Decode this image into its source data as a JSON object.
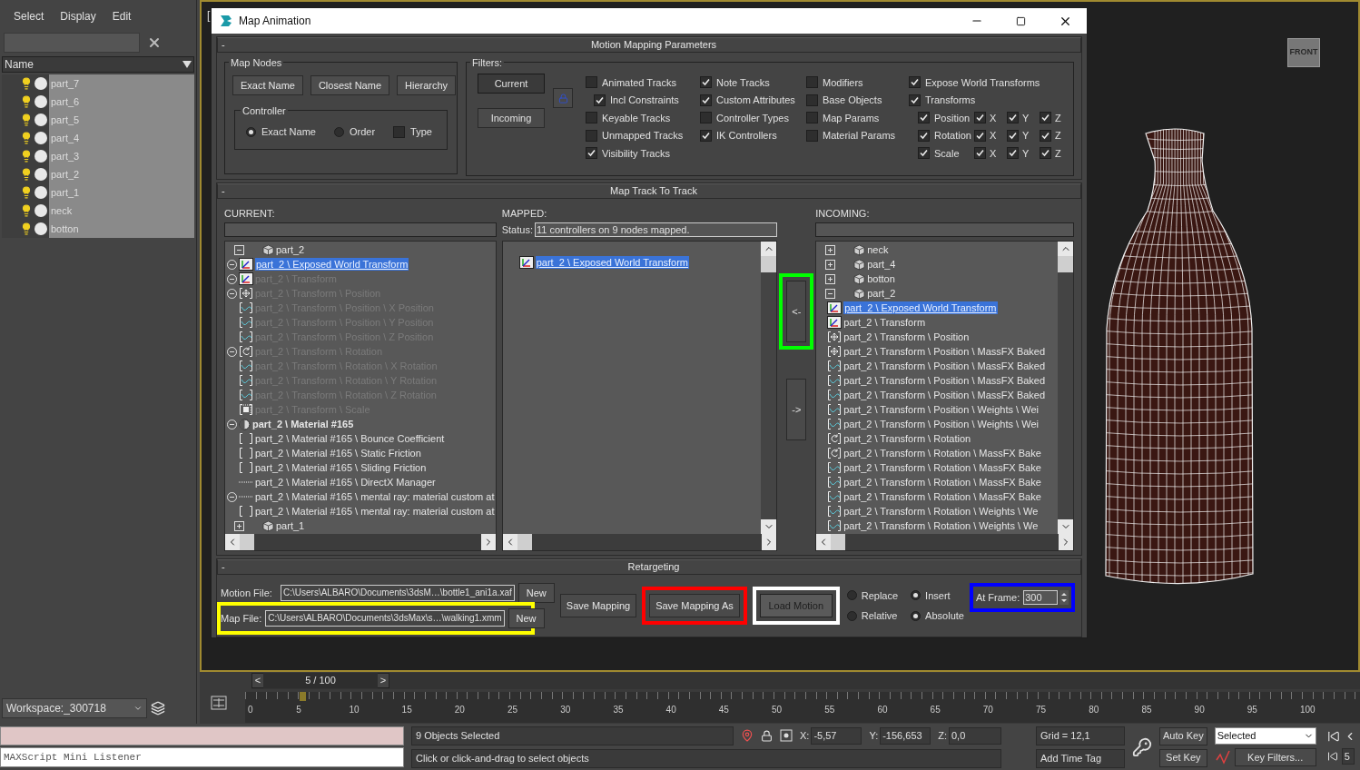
{
  "explorer": {
    "menu": [
      "Select",
      "Display",
      "Edit"
    ],
    "column": "Name",
    "items": [
      {
        "name": "part_7",
        "selected": true
      },
      {
        "name": "part_6",
        "selected": true
      },
      {
        "name": "part_5",
        "selected": true
      },
      {
        "name": "part_4",
        "selected": true
      },
      {
        "name": "part_3",
        "selected": true
      },
      {
        "name": "part_2",
        "selected": true
      },
      {
        "name": "part_1",
        "selected": true
      },
      {
        "name": "neck",
        "selected": true
      },
      {
        "name": "botton",
        "selected": true
      }
    ],
    "workspace": "Workspace:_300718"
  },
  "viewport": {
    "label": "[",
    "viewcube": "FRONT"
  },
  "dialog": {
    "title": "Map Animation",
    "motion_mapping": {
      "collapse": "-",
      "title": "Motion Mapping Parameters",
      "map_nodes": {
        "title": "Map Nodes",
        "buttons": [
          "Exact Name",
          "Closest Name",
          "Hierarchy"
        ],
        "controller": {
          "title": "Controller",
          "options": [
            {
              "label": "Exact Name",
              "kind": "radio",
              "selected": true
            },
            {
              "label": "Order",
              "kind": "radio",
              "selected": false
            },
            {
              "label": "Type",
              "kind": "checkbox",
              "checked": false
            }
          ]
        }
      },
      "filters": {
        "title": "Filters:",
        "modes": [
          {
            "label": "Current",
            "selected": true
          },
          {
            "label": "Incoming",
            "selected": false
          }
        ],
        "columns": [
          [
            {
              "label": "Animated Tracks",
              "checked": false,
              "kind": "plain"
            },
            {
              "label": "Incl Constraints",
              "checked": true,
              "kind": "sub"
            },
            {
              "label": "Keyable Tracks",
              "checked": false,
              "kind": "plain"
            },
            {
              "label": "Unmapped Tracks",
              "checked": false,
              "kind": "plain"
            },
            {
              "label": "Visibility Tracks",
              "checked": true,
              "kind": "plain"
            }
          ],
          [
            {
              "label": "Note Tracks",
              "checked": true,
              "kind": "plain"
            },
            {
              "label": "Custom Attributes",
              "checked": true,
              "kind": "plain"
            },
            {
              "label": "Controller Types",
              "checked": false,
              "kind": "plain"
            },
            {
              "label": "IK Controllers",
              "checked": true,
              "kind": "plain"
            }
          ],
          [
            {
              "label": "Modifiers",
              "checked": false,
              "kind": "plain"
            },
            {
              "label": "Base Objects",
              "checked": false,
              "kind": "plain"
            },
            {
              "label": "Map Params",
              "checked": false,
              "kind": "plain"
            },
            {
              "label": "Material Params",
              "checked": false,
              "kind": "plain"
            }
          ],
          [
            {
              "label": "Expose World Transforms",
              "checked": true,
              "kind": "plain"
            },
            {
              "label": "Transforms",
              "checked": true,
              "kind": "plain"
            }
          ]
        ],
        "transforms": [
          {
            "label": "Position",
            "checked": true,
            "axes": [
              {
                "label": "X",
                "checked": true
              },
              {
                "label": "Y",
                "checked": true
              },
              {
                "label": "Z",
                "checked": true
              }
            ]
          },
          {
            "label": "Rotation",
            "checked": true,
            "axes": [
              {
                "label": "X",
                "checked": true
              },
              {
                "label": "Y",
                "checked": true
              },
              {
                "label": "Z",
                "checked": true
              }
            ]
          },
          {
            "label": "Scale",
            "checked": true,
            "axes": [
              {
                "label": "X",
                "checked": true
              },
              {
                "label": "Y",
                "checked": true
              },
              {
                "label": "Z",
                "checked": true
              }
            ]
          }
        ]
      }
    },
    "map_track": {
      "collapse": "-",
      "title": "Map Track To Track",
      "current": {
        "label": "CURRENT:",
        "rows": [
          {
            "text": "part_2",
            "kind": "node",
            "expanded": true,
            "selected": false,
            "disabled": false
          },
          {
            "text": "part_2 \\ Exposed World Transform",
            "kind": "transform",
            "expanded": true,
            "selected": true,
            "disabled": false
          },
          {
            "text": "part_2 \\ Transform",
            "kind": "transform",
            "expanded": true,
            "selected": false,
            "disabled": true
          },
          {
            "text": "part_2 \\ Transform \\ Position",
            "kind": "position",
            "expanded": true,
            "selected": false,
            "disabled": true
          },
          {
            "text": "part_2 \\ Transform \\ Position \\ X Position",
            "kind": "curve",
            "selected": false,
            "disabled": true
          },
          {
            "text": "part_2 \\ Transform \\ Position \\ Y Position",
            "kind": "curve",
            "selected": false,
            "disabled": true
          },
          {
            "text": "part_2 \\ Transform \\ Position \\ Z Position",
            "kind": "curve",
            "selected": false,
            "disabled": true
          },
          {
            "text": "part_2 \\ Transform \\ Rotation",
            "kind": "rotation",
            "expanded": true,
            "selected": false,
            "disabled": true
          },
          {
            "text": "part_2 \\ Transform \\ Rotation \\ X Rotation",
            "kind": "curve",
            "selected": false,
            "disabled": true
          },
          {
            "text": "part_2 \\ Transform \\ Rotation \\ Y Rotation",
            "kind": "curve",
            "selected": false,
            "disabled": true
          },
          {
            "text": "part_2 \\ Transform \\ Rotation \\ Z Rotation",
            "kind": "curve",
            "selected": false,
            "disabled": true
          },
          {
            "text": "part_2 \\ Transform \\ Scale",
            "kind": "scale",
            "selected": false,
            "disabled": true
          },
          {
            "text": "part_2 \\ Material #165",
            "kind": "material",
            "expanded": true,
            "selected": false,
            "disabled": false
          },
          {
            "text": "part_2 \\ Material #165 \\ Bounce Coefficient",
            "kind": "bracket",
            "selected": false,
            "disabled": false
          },
          {
            "text": "part_2 \\ Material #165 \\ Static Friction",
            "kind": "bracket",
            "selected": false,
            "disabled": false
          },
          {
            "text": "part_2 \\ Material #165 \\ Sliding Friction",
            "kind": "bracket",
            "selected": false,
            "disabled": false
          },
          {
            "text": "part_2 \\ Material #165 \\ DirectX Manager",
            "kind": "dotted",
            "selected": false,
            "disabled": false
          },
          {
            "text": "part_2 \\ Material #165 \\ mental ray: material custom at",
            "kind": "dotted",
            "expanded": true,
            "selected": false,
            "disabled": false
          },
          {
            "text": "part_2 \\ Material #165 \\ mental ray: material custom at",
            "kind": "bracket",
            "selected": false,
            "disabled": false
          },
          {
            "text": "part_1",
            "kind": "node",
            "expanded": false,
            "selected": false,
            "disabled": false
          }
        ]
      },
      "mapped": {
        "label": "MAPPED:",
        "status_label": "Status:",
        "status": "11 controllers on 9 nodes mapped.",
        "rows": [
          {
            "text": "part_2 \\ Exposed World Transform",
            "kind": "transform",
            "selected": true,
            "disabled": false
          }
        ]
      },
      "arrows": [
        {
          "label": "<-",
          "color": "#00ff00"
        },
        {
          "label": "->"
        }
      ],
      "incoming": {
        "label": "INCOMING:",
        "rows": [
          {
            "text": "neck",
            "kind": "node",
            "expanded": false,
            "selected": false,
            "disabled": false
          },
          {
            "text": "part_4",
            "kind": "node",
            "expanded": false,
            "selected": false,
            "disabled": false
          },
          {
            "text": "botton",
            "kind": "node",
            "expanded": false,
            "selected": false,
            "disabled": false
          },
          {
            "text": "part_2",
            "kind": "node",
            "expanded": true,
            "selected": false,
            "disabled": false
          },
          {
            "text": "part_2 \\ Exposed World Transform",
            "kind": "transform",
            "selected": true,
            "disabled": false
          },
          {
            "text": "part_2 \\ Transform",
            "kind": "transform",
            "selected": false,
            "disabled": false
          },
          {
            "text": "part_2 \\ Transform \\ Position",
            "kind": "position",
            "selected": false,
            "disabled": false
          },
          {
            "text": "part_2 \\ Transform \\ Position \\ MassFX Baked",
            "kind": "position",
            "selected": false,
            "disabled": false
          },
          {
            "text": "part_2 \\ Transform \\ Position \\ MassFX Baked",
            "kind": "curve",
            "selected": false,
            "disabled": false
          },
          {
            "text": "part_2 \\ Transform \\ Position \\ MassFX Baked",
            "kind": "curve",
            "selected": false,
            "disabled": false
          },
          {
            "text": "part_2 \\ Transform \\ Position \\ MassFX Baked",
            "kind": "curve",
            "selected": false,
            "disabled": false
          },
          {
            "text": "part_2 \\ Transform \\ Position \\ Weights \\ Wei",
            "kind": "curve",
            "selected": false,
            "disabled": false
          },
          {
            "text": "part_2 \\ Transform \\ Position \\ Weights \\ Wei",
            "kind": "curve",
            "selected": false,
            "disabled": false
          },
          {
            "text": "part_2 \\ Transform \\ Rotation",
            "kind": "rotation",
            "selected": false,
            "disabled": false
          },
          {
            "text": "part_2 \\ Transform \\ Rotation \\ MassFX Bake",
            "kind": "rotation",
            "selected": false,
            "disabled": false
          },
          {
            "text": "part_2 \\ Transform \\ Rotation \\ MassFX Bake",
            "kind": "curve",
            "selected": false,
            "disabled": false
          },
          {
            "text": "part_2 \\ Transform \\ Rotation \\ MassFX Bake",
            "kind": "curve",
            "selected": false,
            "disabled": false
          },
          {
            "text": "part_2 \\ Transform \\ Rotation \\ MassFX Bake",
            "kind": "curve",
            "selected": false,
            "disabled": false
          },
          {
            "text": "part_2 \\ Transform \\ Rotation \\ Weights \\ We",
            "kind": "curve",
            "selected": false,
            "disabled": false
          },
          {
            "text": "part_2 \\ Transform \\ Rotation \\ Weights \\ We",
            "kind": "curve",
            "selected": false,
            "disabled": false
          }
        ]
      }
    },
    "retargeting": {
      "collapse": "-",
      "title": "Retargeting",
      "files": [
        {
          "label": "Motion File:",
          "value": "C:\\Users\\ALBARO\\Documents\\3dsM…\\bottle1_ani1a.xaf",
          "button": "New"
        },
        {
          "label": "Map File:",
          "value": "C:\\Users\\ALBARO\\Documents\\3dsMax\\s…\\walking1.xmm",
          "button": "New",
          "color": "#ffff00"
        }
      ],
      "actions": [
        {
          "label": "Save Mapping",
          "disabled": false
        },
        {
          "label": "Save Mapping As",
          "disabled": false,
          "color": "#ff0000"
        },
        {
          "label": "Load Motion",
          "disabled": true,
          "color": "#ffffff"
        }
      ],
      "modes": [
        [
          {
            "label": "Replace",
            "selected": false
          },
          {
            "label": "Relative",
            "selected": false
          }
        ],
        [
          {
            "label": "Insert",
            "selected": true
          },
          {
            "label": "Absolute",
            "selected": true
          }
        ]
      ],
      "at_frame": {
        "label": "At Frame:",
        "value": "300",
        "color": "#0000ff"
      }
    }
  },
  "timeline": {
    "slider": {
      "prev": "<",
      "label": "5 / 100",
      "next": ">"
    },
    "ticks": [
      "0",
      "5",
      "10",
      "15",
      "20",
      "25",
      "30",
      "35",
      "40",
      "45",
      "50",
      "55",
      "60",
      "65",
      "70",
      "75",
      "80",
      "85",
      "90",
      "95",
      "100"
    ]
  },
  "status": {
    "listener": "MAXScript Mini Listener",
    "selection": "9 Objects Selected",
    "prompt": "Click or click-and-drag to select objects",
    "coords": [
      {
        "label": "X:",
        "value": "-5,57"
      },
      {
        "label": "Y:",
        "value": "-156,653"
      },
      {
        "label": "Z:",
        "value": "0,0"
      }
    ],
    "grid": "Grid = 12,1",
    "time_tag": "Add Time Tag",
    "auto_key": "Auto Key",
    "key_mode": "Selected",
    "set_key": "Set Key",
    "key_filters": "Key Filters...",
    "frame": "5"
  }
}
